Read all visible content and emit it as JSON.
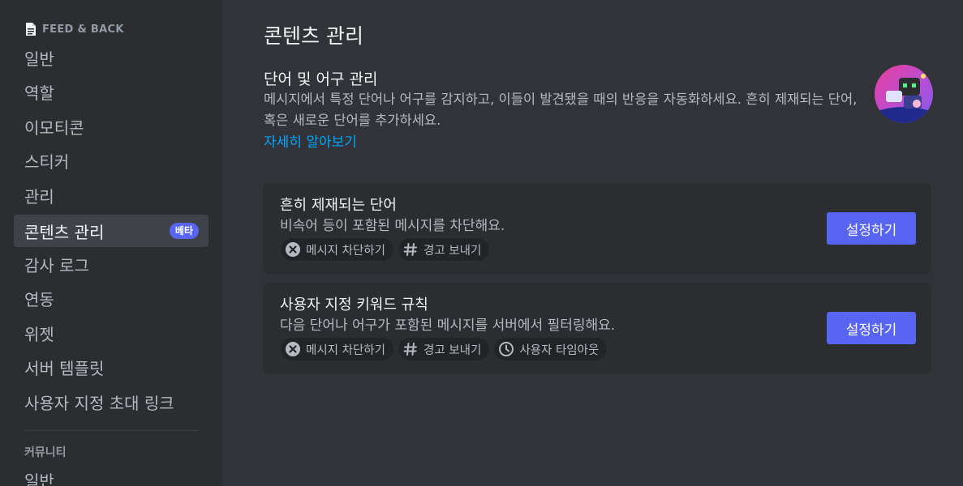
{
  "sidebar": {
    "server_name": "FEED & BACK",
    "items": [
      {
        "label": "일반"
      },
      {
        "label": "역할"
      },
      {
        "label": "이모티콘"
      },
      {
        "label": "스티커"
      },
      {
        "label": "관리"
      },
      {
        "label": "콘텐츠 관리",
        "badge": "베타",
        "active": true
      },
      {
        "label": "감사 로그"
      },
      {
        "label": "연동"
      },
      {
        "label": "위젯"
      },
      {
        "label": "서버 템플릿"
      },
      {
        "label": "사용자 지정 초대 링크"
      }
    ],
    "community_section": "커뮤니티",
    "community_items": [
      {
        "label": "일반"
      }
    ]
  },
  "main": {
    "title": "콘텐츠 관리",
    "section_title": "단어 및 어구 관리",
    "section_desc": "메시지에서 특정 단어나 어구를 감지하고, 이들이 발견됐을 때의 반응을 자동화하세요. 흔히 제재되는 단어, 혹은 새로운 단어를 추가하세요.",
    "learn_more": "자세히 알아보기",
    "rules": [
      {
        "title": "흔히 제재되는 단어",
        "desc": "비속어 등이 포함된 메시지를 차단해요.",
        "chips": [
          "메시지 차단하기",
          "경고 보내기"
        ],
        "button": "설정하기"
      },
      {
        "title": "사용자 지정 키워드 규칙",
        "desc": "다음 단어나 어구가 포함된 메시지를 서버에서 필터링해요.",
        "chips": [
          "메시지 차단하기",
          "경고 보내기",
          "사용자 타임아웃"
        ],
        "button": "설정하기"
      }
    ]
  },
  "colors": {
    "accent": "#5865f2",
    "link": "#00a8fc",
    "sidebar_bg": "#2b2d31",
    "main_bg": "#313338"
  },
  "icons": {
    "server": "document-icon",
    "block": "x-circle-icon",
    "alert": "hashtag-icon",
    "timeout": "clock-icon"
  }
}
